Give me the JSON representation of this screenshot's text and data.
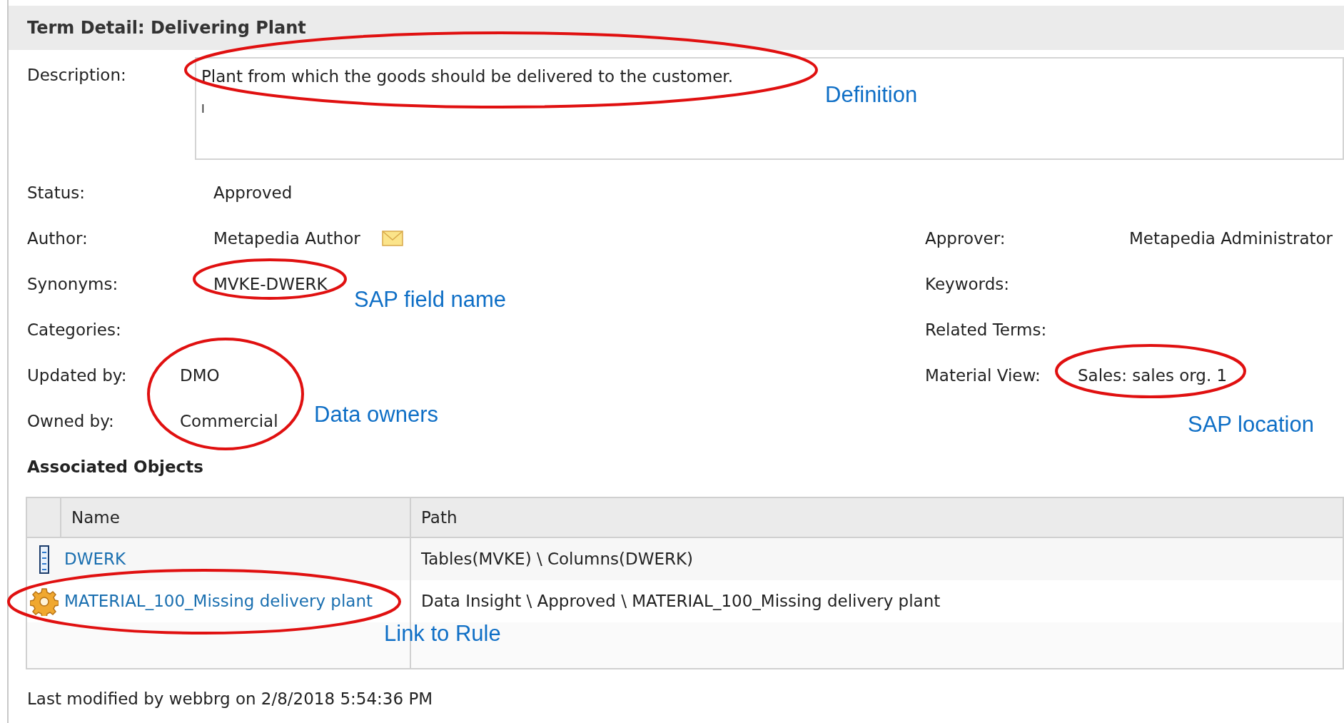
{
  "panel": {
    "title": "Term Detail: Delivering Plant"
  },
  "description": {
    "label": "Description:",
    "value": "Plant from which the goods should be delivered to the customer.",
    "second_line": "I"
  },
  "fields": [
    {
      "label": "Status:",
      "value": "Approved"
    },
    {
      "label": "Author:",
      "value": "Metapedia Author"
    },
    {
      "label": "Synonyms:",
      "value": "MVKE-DWERK"
    },
    {
      "label": "Categories:"
    },
    {
      "label": "Updated by:",
      "value": "DMO"
    },
    {
      "label": "Owned by:",
      "value": "Commercial"
    }
  ],
  "right_fields": [
    {
      "label": "Approver:",
      "value": "Metapedia Administrator"
    },
    {
      "label": "Keywords:"
    },
    {
      "label": "Related Terms:"
    },
    {
      "label": "Material View:",
      "value": "Sales: sales org. 1"
    }
  ],
  "associated_objects": {
    "title": "Associated Objects",
    "columns": [
      "Name",
      "Path"
    ],
    "rows": [
      {
        "kind": "column",
        "name": "DWERK",
        "path": "Tables(MVKE) \\ Columns(DWERK)"
      },
      {
        "kind": "rule",
        "name": "MATERIAL_100_Missing delivery plant",
        "path": "Data Insight \\ Approved \\ MATERIAL_100_Missing delivery plant"
      }
    ]
  },
  "footer": "Last modified by webbrg on 2/8/2018 5:54:36 PM",
  "annotations": [
    "Definition",
    "SAP field name",
    "Data owners",
    "SAP location",
    "Link to Rule"
  ]
}
